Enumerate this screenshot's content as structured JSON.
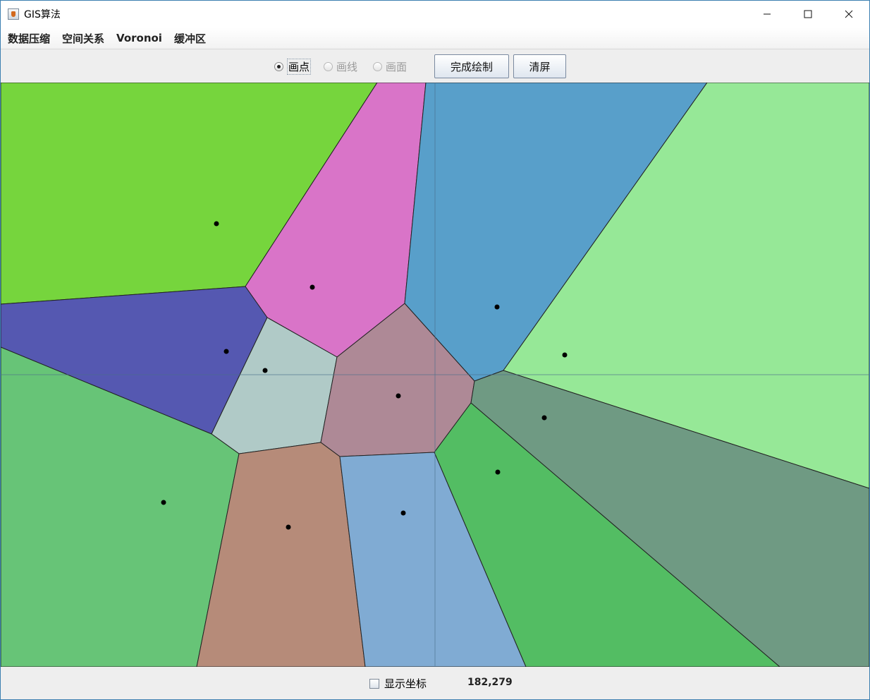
{
  "window": {
    "title": "GIS算法"
  },
  "menu": {
    "items": [
      "数据压缩",
      "空间关系",
      "Voronoi",
      "缓冲区"
    ]
  },
  "toolbar": {
    "modes": [
      {
        "label": "画点",
        "checked": true,
        "enabled": true
      },
      {
        "label": "画线",
        "checked": false,
        "enabled": false
      },
      {
        "label": "画面",
        "checked": false,
        "enabled": false
      }
    ],
    "finish_label": "完成绘制",
    "clear_label": "清屏"
  },
  "status": {
    "show_coords_label": "显示坐标",
    "show_coords_checked": false,
    "coordinates": "182,279"
  },
  "voronoi": {
    "edge_color": "#222222",
    "site_color": "#000000",
    "cursor_guide_color": "#4a6e8a"
  }
}
